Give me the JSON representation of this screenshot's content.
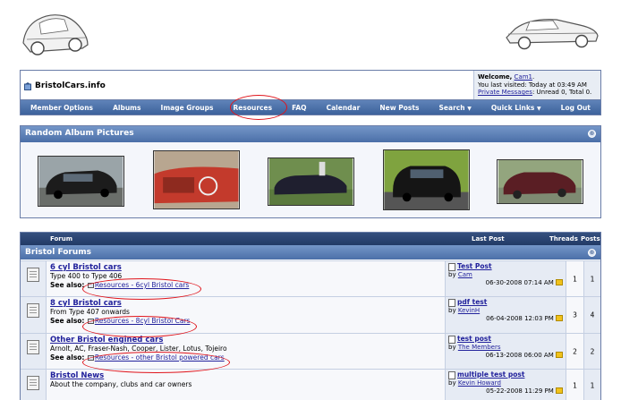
{
  "site": {
    "name": "BristolCars.info"
  },
  "welcome": {
    "greeting": "Welcome,",
    "user": "Cam1",
    "greeting_end": ".",
    "last_visit": "You last visited: Today at",
    "last_visit_time": "03:49 AM",
    "pm_label": "Private Messages",
    "pm_status": ": Unread 0, Total 0."
  },
  "navbar": {
    "items": [
      "Member Options",
      "Albums",
      "Image Groups",
      "Resources",
      "FAQ",
      "Calendar",
      "New Posts",
      "Search",
      "Quick Links",
      "Log Out"
    ],
    "dropdown_glyph": "▼"
  },
  "album": {
    "title": "Random Album Pictures",
    "collapse_glyph": "®"
  },
  "table": {
    "col_forum": "Forum",
    "col_last_post": "Last Post",
    "col_threads": "Threads",
    "col_posts": "Posts",
    "category": "Bristol Forums",
    "see_also_label": "See also:"
  },
  "forums": [
    {
      "title": "6 cyl Bristol cars",
      "desc": "Type 400 to Type 406",
      "see_also": "Resources - 6cyl Bristol cars",
      "last_post_title": "Test Post",
      "last_post_by": "by",
      "last_post_user": "Cam",
      "last_post_date": "06-30-2008",
      "last_post_time": "07:14 AM",
      "threads": "1",
      "posts": "1"
    },
    {
      "title": "8 cyl Bristol cars",
      "desc": "From Type 407 onwards",
      "see_also": "Resources - 8cyl Bristol Cars",
      "last_post_title": "pdf test",
      "last_post_by": "by",
      "last_post_user": "KevinH",
      "last_post_date": "06-04-2008",
      "last_post_time": "12:03 PM",
      "threads": "3",
      "posts": "4"
    },
    {
      "title": "Other Bristol engined cars",
      "desc": "Arnolt, AC, Fraser-Nash, Cooper, Lister, Lotus, Tojeiro",
      "see_also": "Resources - other Bristol powered cars",
      "last_post_title": "test post",
      "last_post_by": "by",
      "last_post_user": "The Members",
      "last_post_date": "06-13-2008",
      "last_post_time": "06:00 AM",
      "threads": "2",
      "posts": "2"
    },
    {
      "title": "Bristol News",
      "desc": "About the company, clubs and car owners",
      "see_also": "",
      "last_post_title": "multiple test post",
      "last_post_by": "by",
      "last_post_user": "Kevin Howard",
      "last_post_date": "05-22-2008",
      "last_post_time": "11:29 PM",
      "threads": "1",
      "posts": "1"
    }
  ],
  "colors": {
    "nav": "#4b6fa8",
    "link": "#22229c",
    "highlight_circle": "#e0141b"
  }
}
